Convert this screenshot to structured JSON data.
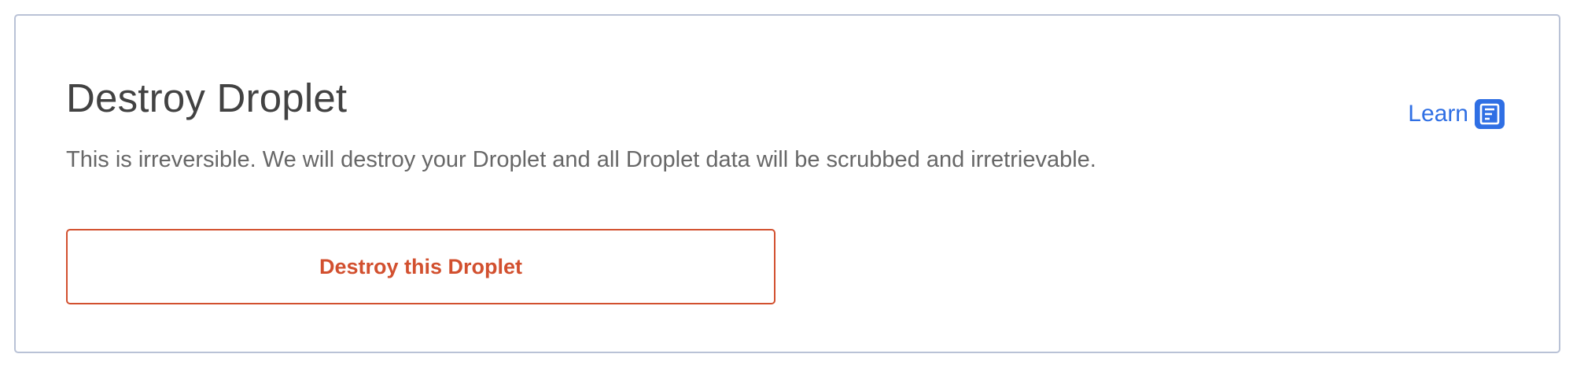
{
  "section": {
    "title": "Destroy Droplet",
    "description": "This is irreversible. We will destroy your Droplet and all Droplet data will be scrubbed and irretrievable.",
    "learn_label": "Learn",
    "learn_icon": "document-icon",
    "destroy_button_label": "Destroy this Droplet"
  },
  "colors": {
    "link": "#2f6fe4",
    "danger": "#d2502f",
    "border": "#b9c2d6",
    "title": "#424242",
    "text": "#676767"
  }
}
